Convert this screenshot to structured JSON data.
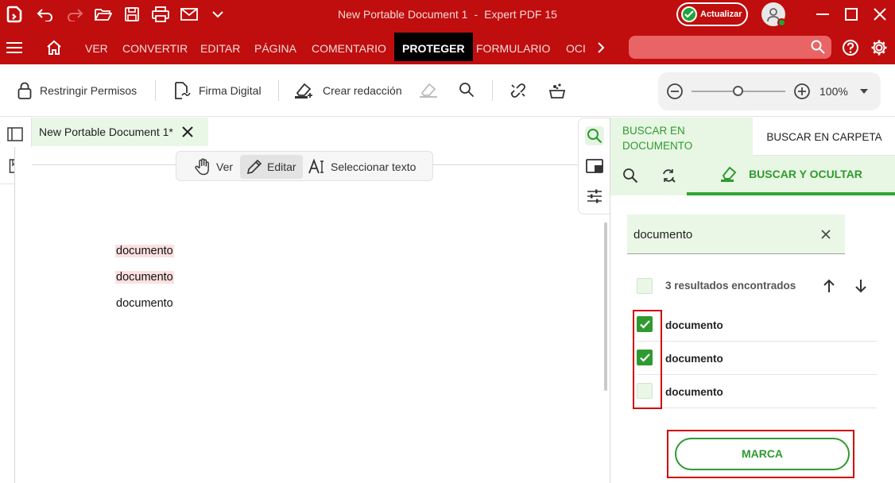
{
  "window": {
    "title": "New Portable Document 1",
    "separator": "-",
    "app_name": "Expert PDF 15",
    "update_label": "Actualizar"
  },
  "menu": {
    "items": [
      "VER",
      "CONVERTIR",
      "EDITAR",
      "PÁGINA",
      "COMENTARIO",
      "PROTEGER",
      "FORMULARIO",
      "OCI"
    ],
    "active": "PROTEGER"
  },
  "toolbar": {
    "restrict_label": "Restringir Permisos",
    "sign_label": "Firma Digital",
    "redact_label": "Crear redacción",
    "zoom_value": "100%",
    "zoom_level": 0.5
  },
  "document": {
    "tab_title": "New Portable Document 1*",
    "modes": {
      "view": "Ver",
      "edit": "Editar",
      "select": "Seleccionar texto",
      "active": "Editar"
    },
    "lines": [
      {
        "text": "documento",
        "highlighted": true
      },
      {
        "text": "documento",
        "highlighted": true
      },
      {
        "text": "documento",
        "highlighted": false
      }
    ]
  },
  "panel": {
    "tab_document": "BUSCAR EN DOCUMENTO",
    "tab_folder": "BUSCAR EN CARPETA",
    "subtab_active": "BUSCAR Y OCULTAR",
    "search_value": "documento",
    "results_text": "3 resultados encontrados",
    "results": [
      {
        "label": "documento",
        "checked": true
      },
      {
        "label": "documento",
        "checked": true
      },
      {
        "label": "documento",
        "checked": false
      }
    ],
    "mark_button": "MARCA"
  },
  "colors": {
    "brand_red": "#c00d0d",
    "accent_green": "#2f9a2f",
    "highlight": "#fbe0e0",
    "annotation_red": "#d00000"
  }
}
